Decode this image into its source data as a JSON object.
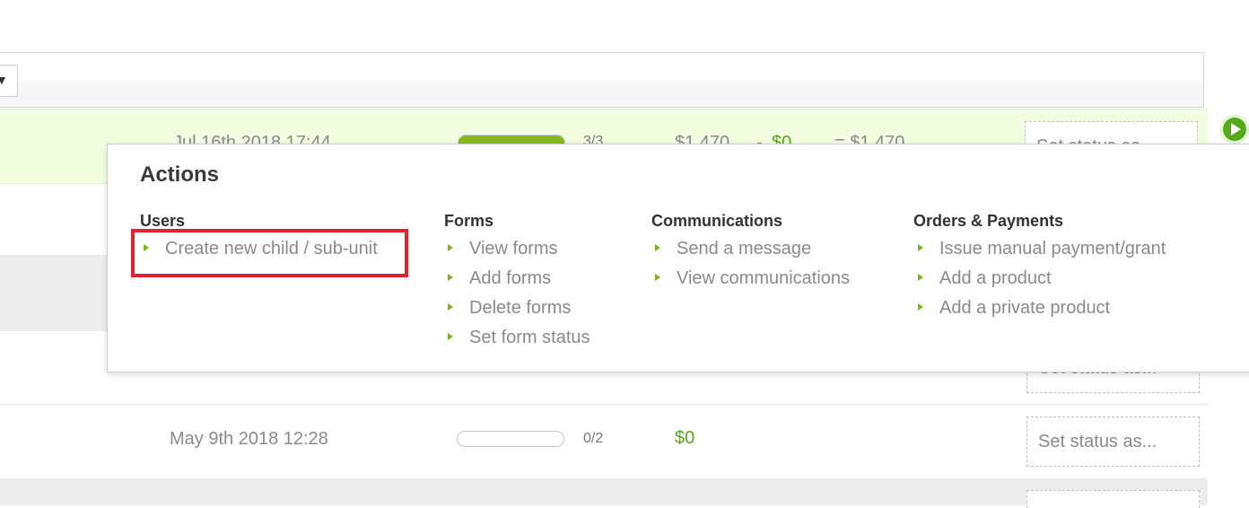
{
  "filter": {
    "dropdown_glyph": "▼"
  },
  "rows": [
    {
      "date": "Jul 16th 2018 17:44",
      "progress_fraction": 1.0,
      "ratio": "3/3",
      "total": "$1,470",
      "minus": "-",
      "discount": "$0",
      "equals": "= $1,470",
      "status": "Set status as..."
    },
    {
      "date": "May 9th 2018 12:28",
      "progress_fraction": 0.0,
      "ratio": "0/2",
      "total": "$0",
      "status": "Set status as..."
    }
  ],
  "partial_status": "Set status as...",
  "popup": {
    "title": "Actions",
    "groups": [
      {
        "heading": "Users",
        "items": [
          "Create new child / sub-unit"
        ]
      },
      {
        "heading": "Forms",
        "items": [
          "View forms",
          "Add forms",
          "Delete forms",
          "Set form status"
        ]
      },
      {
        "heading": "Communications",
        "items": [
          "Send a message",
          "View communications"
        ]
      },
      {
        "heading": "Orders & Payments",
        "items": [
          "Issue manual payment/grant",
          "Add a product",
          "Add a private product"
        ]
      }
    ]
  },
  "colors": {
    "accent_green": "#84b81c",
    "money_green": "#5aa51c",
    "highlight_red": "#e0232e",
    "row_green": "#f3fddf"
  },
  "icons": {
    "row_action": "play-icon",
    "bullet": "triangle-bullet-icon",
    "dropdown": "chevron-down-icon"
  }
}
